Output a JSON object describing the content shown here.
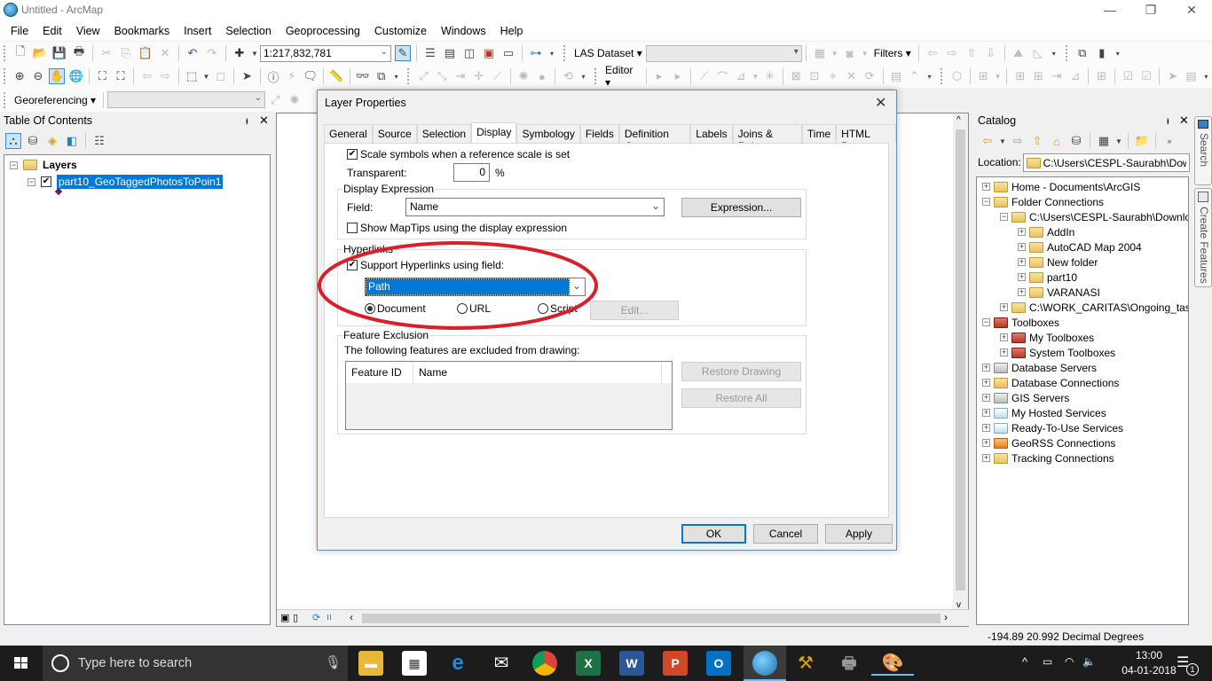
{
  "window": {
    "title": "Untitled - ArcMap",
    "minimize_label": "—",
    "restore_label": "❐",
    "close_label": "✕"
  },
  "menubar": [
    "File",
    "Edit",
    "View",
    "Bookmarks",
    "Insert",
    "Selection",
    "Geoprocessing",
    "Customize",
    "Windows",
    "Help"
  ],
  "toolbar1": {
    "scale_value": "1:217,832,781",
    "las_dataset_label": "LAS Dataset",
    "las_dataset_value": "",
    "filters_label": "Filters"
  },
  "toolbar2": {
    "editor_label": "Editor"
  },
  "toolbar3": {
    "georeferencing_label": "Georeferencing",
    "layer_combo_value": ""
  },
  "toc": {
    "title": "Table Of Contents",
    "pin": "ᵻ",
    "close": "✕",
    "root_label": "Layers",
    "layer_label": "part10_GeoTaggedPhotosToPoin1",
    "layer_checked": true,
    "layer_symbol_color": "#6b1e5a"
  },
  "dialog": {
    "title": "Layer Properties",
    "close": "✕",
    "tabs": [
      "General",
      "Source",
      "Selection",
      "Display",
      "Symbology",
      "Fields",
      "Definition Query",
      "Labels",
      "Joins & Relates",
      "Time",
      "HTML Popup"
    ],
    "active_tab": "Display",
    "scale_symbols_label": "Scale symbols when a reference scale is set",
    "scale_symbols_checked": true,
    "transparent_label": "Transparent:",
    "transparent_value": "0",
    "transparent_unit": "%",
    "display_expression": {
      "group_label": "Display Expression",
      "field_label": "Field:",
      "field_value": "Name",
      "expression_button": "Expression...",
      "maptips_label": "Show MapTips using the display expression",
      "maptips_checked": false
    },
    "hyperlinks": {
      "group_label": "Hyperlinks",
      "support_label": "Support Hyperlinks using field:",
      "support_checked": true,
      "field_value": "Path",
      "radio_document": "Document",
      "radio_url": "URL",
      "radio_script": "Script",
      "selected_radio": "Document",
      "edit_button": "Edit..."
    },
    "feature_exclusion": {
      "group_label": "Feature Exclusion",
      "description": "The following features are excluded from drawing:",
      "columns": [
        "Feature ID",
        "Name"
      ],
      "rows": [],
      "restore_drawing_button": "Restore Drawing",
      "restore_all_button": "Restore All"
    },
    "ok_button": "OK",
    "cancel_button": "Cancel",
    "apply_button": "Apply",
    "annotation_color": "#d9202a"
  },
  "catalog": {
    "title": "Catalog",
    "pin": "ᵻ",
    "close": "✕",
    "location_label": "Location:",
    "location_value": "C:\\Users\\CESPL-Saurabh\\Dow",
    "items": [
      {
        "label": "Home - Documents\\ArcGIS",
        "level": 0,
        "exp": "+",
        "icon": "home-folder"
      },
      {
        "label": "Folder Connections",
        "level": 0,
        "exp": "−",
        "icon": "folder-connections"
      },
      {
        "label": "C:\\Users\\CESPL-Saurabh\\Downlo",
        "level": 1,
        "exp": "−",
        "icon": "folder-connection"
      },
      {
        "label": "AddIn",
        "level": 2,
        "exp": "+",
        "icon": "folder"
      },
      {
        "label": "AutoCAD Map 2004",
        "level": 2,
        "exp": "+",
        "icon": "folder"
      },
      {
        "label": "New folder",
        "level": 2,
        "exp": "+",
        "icon": "folder"
      },
      {
        "label": "part10",
        "level": 2,
        "exp": "+",
        "icon": "folder"
      },
      {
        "label": "VARANASI",
        "level": 2,
        "exp": "+",
        "icon": "folder"
      },
      {
        "label": "C:\\WORK_CARITAS\\Ongoing_tasl",
        "level": 1,
        "exp": "+",
        "icon": "folder-connection"
      },
      {
        "label": "Toolboxes",
        "level": 0,
        "exp": "−",
        "icon": "toolbox"
      },
      {
        "label": "My Toolboxes",
        "level": 1,
        "exp": "+",
        "icon": "toolbox"
      },
      {
        "label": "System Toolboxes",
        "level": 1,
        "exp": "+",
        "icon": "toolbox"
      },
      {
        "label": "Database Servers",
        "level": 0,
        "exp": "+",
        "icon": "database-servers"
      },
      {
        "label": "Database Connections",
        "level": 0,
        "exp": "+",
        "icon": "database-connections"
      },
      {
        "label": "GIS Servers",
        "level": 0,
        "exp": "+",
        "icon": "gis-servers"
      },
      {
        "label": "My Hosted Services",
        "level": 0,
        "exp": "+",
        "icon": "hosted-services"
      },
      {
        "label": "Ready-To-Use Services",
        "level": 0,
        "exp": "+",
        "icon": "ready-services"
      },
      {
        "label": "GeoRSS Connections",
        "level": 0,
        "exp": "+",
        "icon": "georss"
      },
      {
        "label": "Tracking Connections",
        "level": 0,
        "exp": "+",
        "icon": "tracking"
      }
    ]
  },
  "side_tabs": [
    "Search",
    "Create Features"
  ],
  "status": {
    "coordinates": "-194.89  20.992 Decimal Degrees"
  },
  "taskbar": {
    "search_placeholder": "Type here to search",
    "time": "13:00",
    "date": "04-01-2018",
    "notification_count": "1",
    "apps": [
      "File Explorer",
      "Microsoft Store",
      "Edge",
      "Mail",
      "Chrome",
      "Excel",
      "Word",
      "PowerPoint",
      "Outlook",
      "ArcMap",
      "ArcCatalog Tools",
      "Printer",
      "Paint"
    ]
  }
}
